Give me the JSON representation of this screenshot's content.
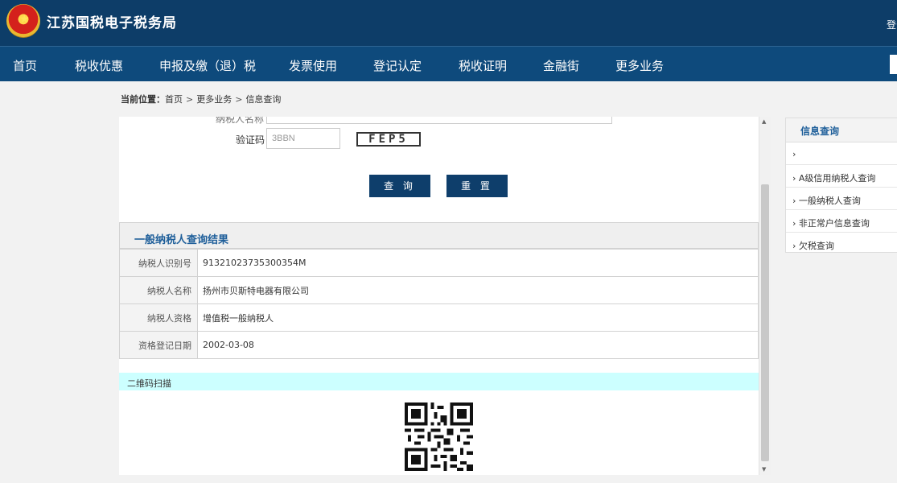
{
  "header": {
    "site_title": "江苏国税电子税务局",
    "login_label": "登录"
  },
  "nav": {
    "items": [
      "首页",
      "税收优惠",
      "申报及缴（退）税",
      "发票使用",
      "登记认定",
      "税收证明",
      "金融街",
      "更多业务"
    ]
  },
  "breadcrumb": {
    "prefix": "当前位置：",
    "items": [
      "首页",
      "更多业务",
      "信息查询"
    ],
    "separator": ">"
  },
  "form": {
    "captcha_label": "验证码",
    "captcha_value": "3BBN",
    "captcha_image_text": "FEP5",
    "query_button": "查 询",
    "reset_button": "重 置"
  },
  "result": {
    "title": "一般纳税人查询结果",
    "rows": [
      {
        "label": "纳税人识别号",
        "value": "91321023735300354M"
      },
      {
        "label": "纳税人名称",
        "value": "扬州市贝斯特电器有限公司"
      },
      {
        "label": "纳税人资格",
        "value": "增值税一般纳税人"
      },
      {
        "label": "资格登记日期",
        "value": "2002-03-08"
      }
    ]
  },
  "qr": {
    "title": "二维码扫描"
  },
  "sidebar": {
    "title": "信息查询",
    "items": [
      "",
      "A级信用纳税人查询",
      "一般纳税人查询",
      "非正常户信息查询",
      "欠税查询"
    ]
  },
  "colors": {
    "header_bg": "#0d3d68",
    "nav_bg": "#0e4a7c",
    "button_bg": "#0e3e6b",
    "accent_text": "#1f5f9a",
    "qr_header_bg": "#ccffff"
  }
}
